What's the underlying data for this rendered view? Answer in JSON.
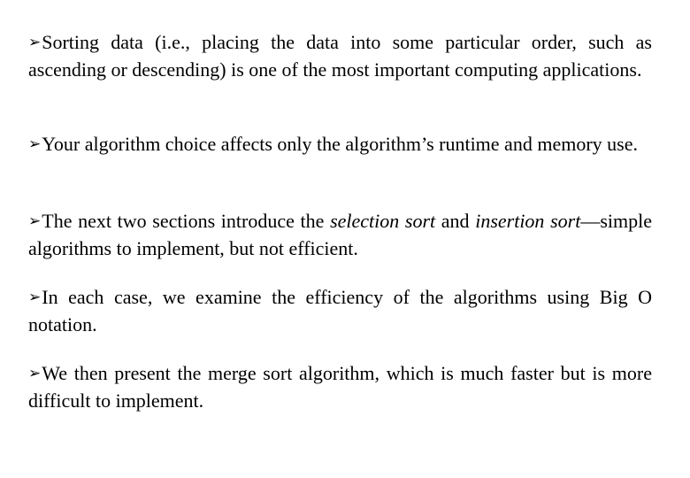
{
  "bullet_glyph": "➢",
  "paragraphs": [
    {
      "text": "Sorting data (i.e., placing the data into some particular order, such as ascending or descending) is one of the most important computing applications."
    },
    {
      "text": "Your algorithm choice affects only the algorithm’s runtime and memory use."
    },
    {
      "pre": "The next two sections introduce the ",
      "em1": "selection sort",
      "mid": " and ",
      "em2": "insertion sort",
      "post": "—simple algorithms to implement, but not efficient."
    },
    {
      "text": "In each case, we examine the efficiency of the algorithms using Big O notation."
    },
    {
      "text": "We then present the merge sort algorithm, which is much faster but is more difficult to implement."
    }
  ]
}
